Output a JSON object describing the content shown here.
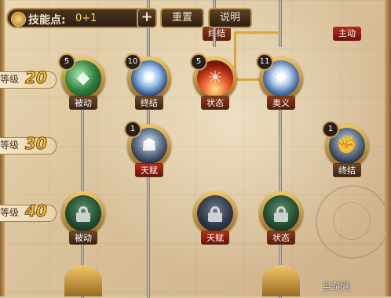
{
  "header": {
    "skill_points_label": "技能点:",
    "skill_points_value": "0+1",
    "plus_label": "+",
    "reset_label": "重置",
    "help_label": "说明"
  },
  "levels": [
    {
      "text": "等级",
      "num": "20"
    },
    {
      "text": "等级",
      "num": "30"
    },
    {
      "text": "等级",
      "num": "40"
    }
  ],
  "partial_tags": {
    "top_center": "终结",
    "top_right": "主动"
  },
  "skills": {
    "r1c1": {
      "count": "5",
      "tag": "被动"
    },
    "r1c2": {
      "count": "10",
      "tag": "终结"
    },
    "r1c3": {
      "count": "5",
      "tag": "状态"
    },
    "r1c4": {
      "count": "11",
      "tag": "奥义"
    },
    "r2c2": {
      "count": "1",
      "tag": "天赋"
    },
    "r2c5": {
      "count": "1",
      "tag": "终结"
    },
    "r3c1": {
      "tag": "被动"
    },
    "r3c3": {
      "tag": "天赋"
    },
    "r3c4": {
      "tag": "状态"
    }
  },
  "watermark": "当游网"
}
